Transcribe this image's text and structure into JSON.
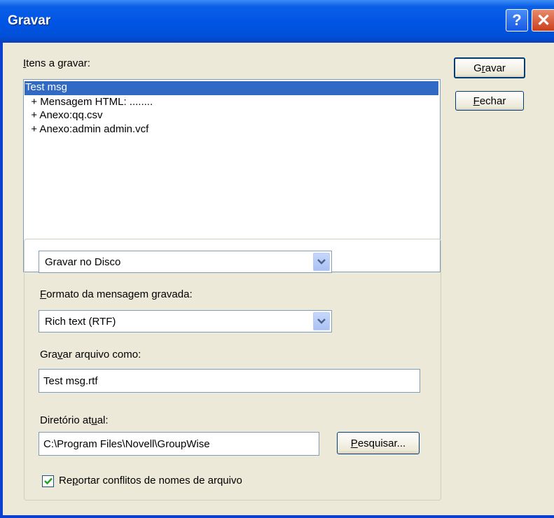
{
  "window": {
    "title": "Gravar",
    "help_glyph": "?",
    "close_glyph": "✕"
  },
  "items_label": {
    "hotkey": "I",
    "rest": "tens a gravar:"
  },
  "items": [
    {
      "text": "Test msg",
      "selected": true
    },
    {
      "text": "  + Mensagem HTML: ........",
      "selected": false
    },
    {
      "text": "  + Anexo:qq.csv",
      "selected": false
    },
    {
      "text": "  + Anexo:admin admin.vcf",
      "selected": false
    }
  ],
  "buttons": {
    "save": {
      "pre": "G",
      "hotkey": "r",
      "rest": "avar"
    },
    "close": {
      "pre": "",
      "hotkey": "F",
      "rest": "echar"
    },
    "browse": {
      "pre": "",
      "hotkey": "P",
      "rest": "esquisar..."
    }
  },
  "destination": {
    "selected": "Gravar no Disco"
  },
  "format": {
    "label_hotkey": "F",
    "label_rest": "ormato da mensagem gravada:",
    "selected": "Rich text (RTF)"
  },
  "filename": {
    "label_pre": "Gra",
    "label_hotkey": "v",
    "label_rest": "ar arquivo como:",
    "value": "Test msg.rtf"
  },
  "directory": {
    "label_pre": "Diretório at",
    "label_hotkey": "u",
    "label_rest": "al:",
    "value": "C:\\Program Files\\Novell\\GroupWise"
  },
  "report_conflicts": {
    "label_pre": "Re",
    "label_hotkey": "p",
    "label_rest": "ortar conflitos de nomes de arquivo",
    "checked": true
  },
  "colors": {
    "titlebar": "#0055e5",
    "selection": "#316ac5",
    "dialog_bg": "#ece9d8"
  }
}
